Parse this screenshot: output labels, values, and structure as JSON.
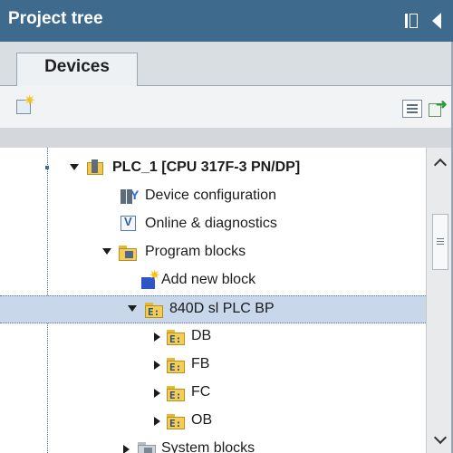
{
  "panel": {
    "title": "Project tree",
    "pin_icon": "pin-icon",
    "collapse_icon": "collapse-arrow-icon"
  },
  "tabs": [
    {
      "label": "Devices",
      "active": true
    }
  ],
  "toolbar": {
    "left_icon": "add-new-device-icon",
    "right_icons": [
      "overview-icon",
      "export-icon"
    ]
  },
  "tree": {
    "rows": [
      {
        "label": "PLC_1 [CPU 317F-3 PN/DP]",
        "icon": "plc-icon",
        "expander": "expanded",
        "bold": true
      },
      {
        "label": "Device configuration",
        "icon": "device-configuration-icon",
        "expander": "none"
      },
      {
        "label": "Online & diagnostics",
        "icon": "online-diagnostics-icon",
        "expander": "none"
      },
      {
        "label": "Program blocks",
        "icon": "program-folder-icon",
        "expander": "expanded"
      },
      {
        "label": "Add new block",
        "icon": "add-new-block-icon",
        "expander": "none"
      },
      {
        "label": "840D sl PLC BP",
        "icon": "block-folder-icon",
        "expander": "expanded",
        "selected": true
      },
      {
        "label": "DB",
        "icon": "block-folder-icon",
        "expander": "collapsed"
      },
      {
        "label": "FB",
        "icon": "block-folder-icon",
        "expander": "collapsed"
      },
      {
        "label": "FC",
        "icon": "block-folder-icon",
        "expander": "collapsed"
      },
      {
        "label": "OB",
        "icon": "block-folder-icon",
        "expander": "collapsed"
      },
      {
        "label": "System blocks",
        "icon": "system-blocks-folder-icon",
        "expander": "collapsed"
      }
    ]
  },
  "colors": {
    "title_bar": "#3e6a8e",
    "selection": "#c8d7ea",
    "tab_strip": "#d9dee3"
  }
}
